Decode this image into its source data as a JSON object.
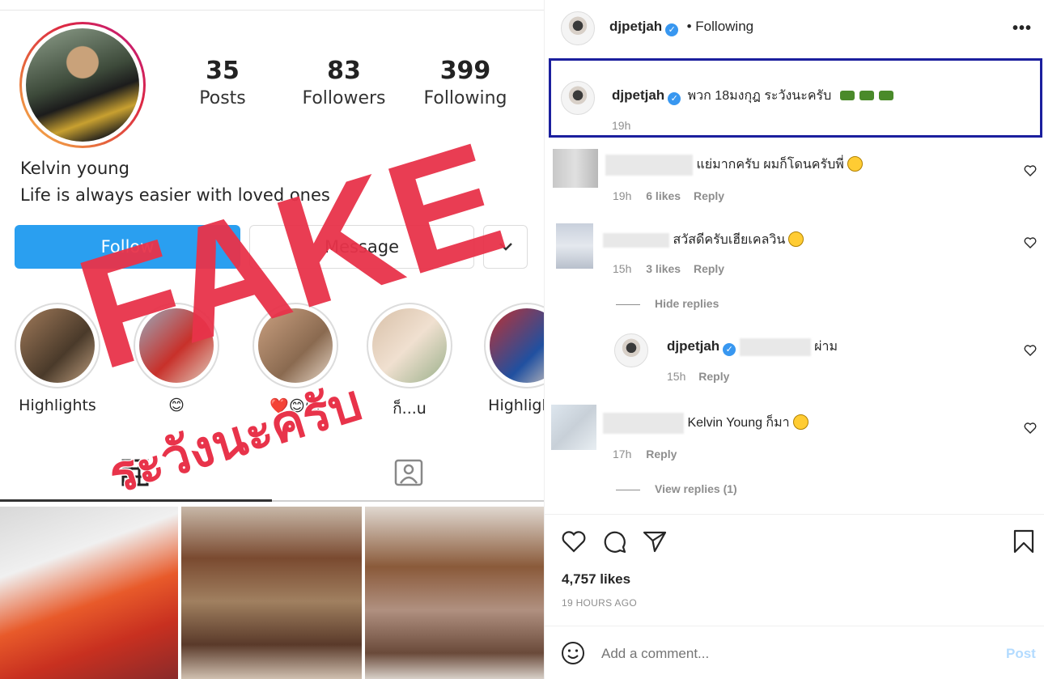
{
  "profile": {
    "posts_count": "35",
    "posts_label": "Posts",
    "followers_count": "83",
    "followers_label": "Followers",
    "following_count": "399",
    "following_label": "Following",
    "name": "Kelvin young",
    "bio": "Life is always easier with loved ones",
    "follow_button": "Follow",
    "message_button": "Message",
    "highlights": [
      {
        "label": "Highlights"
      },
      {
        "label": "😊"
      },
      {
        "label": "❤️😊😊"
      },
      {
        "label": "ก็...u"
      },
      {
        "label": "Highlights"
      }
    ]
  },
  "overlay": {
    "fake_text": "FAKE",
    "warning_text": "ระวังนะครับ"
  },
  "post": {
    "author": "djpetjah",
    "follow_status": "• Following",
    "more_icon": "more-horizontal-icon",
    "caption": "พวก 18มงกุฎ ระวังนะครับ",
    "caption_time": "19h",
    "comments": [
      {
        "text": "แย่มากครับ ผมก็โดนครับพี่",
        "time": "19h",
        "likes": "6 likes",
        "reply": "Reply"
      },
      {
        "text": "สวัสดีครับเฮียเคลวิน",
        "time": "15h",
        "likes": "3 likes",
        "reply": "Reply",
        "toggle": "Hide replies",
        "replies": [
          {
            "author": "djpetjah",
            "text": "ผ่าม",
            "time": "15h",
            "reply": "Reply"
          }
        ]
      },
      {
        "text": "Kelvin Young ก็มา",
        "time": "17h",
        "reply": "Reply",
        "toggle": "View replies (1)"
      }
    ],
    "likes": "4,757 likes",
    "posted_ago": "19 HOURS AGO",
    "comment_placeholder": "Add a comment...",
    "post_button": "Post"
  },
  "colors": {
    "follow_blue": "#2a9ff0",
    "fake_red": "#e8334a",
    "highlight_box": "#1b1f9e",
    "verified": "#3897f0"
  }
}
